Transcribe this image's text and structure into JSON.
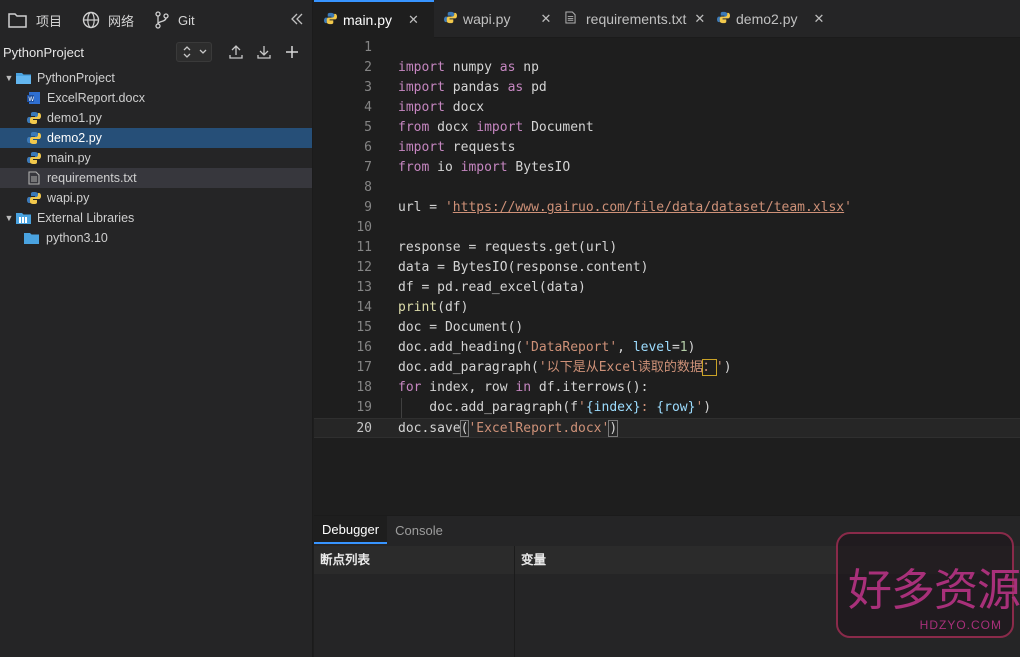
{
  "sidebar": {
    "tabs": [
      {
        "label": "项目",
        "icon": "folder-icon"
      },
      {
        "label": "网络",
        "icon": "globe-icon"
      },
      {
        "label": "Git",
        "icon": "git-branch-icon"
      }
    ],
    "collapse_icon": "double-chevron-left-icon",
    "project_title": "PythonProject",
    "tree": [
      {
        "label": "PythonProject",
        "type": "folder-root",
        "expanded": true,
        "level": 0
      },
      {
        "label": "ExcelReport.docx",
        "type": "docx",
        "level": 1
      },
      {
        "label": "demo1.py",
        "type": "python",
        "level": 1
      },
      {
        "label": "demo2.py",
        "type": "python",
        "level": 1,
        "selected": true
      },
      {
        "label": "main.py",
        "type": "python",
        "level": 1
      },
      {
        "label": "requirements.txt",
        "type": "text",
        "level": 1,
        "hovered": true
      },
      {
        "label": "wapi.py",
        "type": "python",
        "level": 1
      },
      {
        "label": "External Libraries",
        "type": "library",
        "expanded": true,
        "level": 0
      },
      {
        "label": "python3.10",
        "type": "folder",
        "level": 1
      }
    ]
  },
  "editor": {
    "tabs": [
      {
        "label": "main.py",
        "type": "python",
        "active": true
      },
      {
        "label": "wapi.py",
        "type": "python"
      },
      {
        "label": "requirements.txt",
        "type": "text"
      },
      {
        "label": "demo2.py",
        "type": "python"
      }
    ],
    "current_line": 20
  },
  "panel": {
    "tabs": [
      "Debugger",
      "Console"
    ],
    "active_tab": "Debugger",
    "breakpoints_header": "断点列表",
    "variables_header": "变量"
  },
  "watermark": {
    "text": "好多资源哦",
    "sub": "HDZYO.COM"
  },
  "colors": {
    "accent": "#3794ff",
    "selection": "#264f78",
    "keyword": "#569cd6",
    "string": "#ce9178"
  }
}
